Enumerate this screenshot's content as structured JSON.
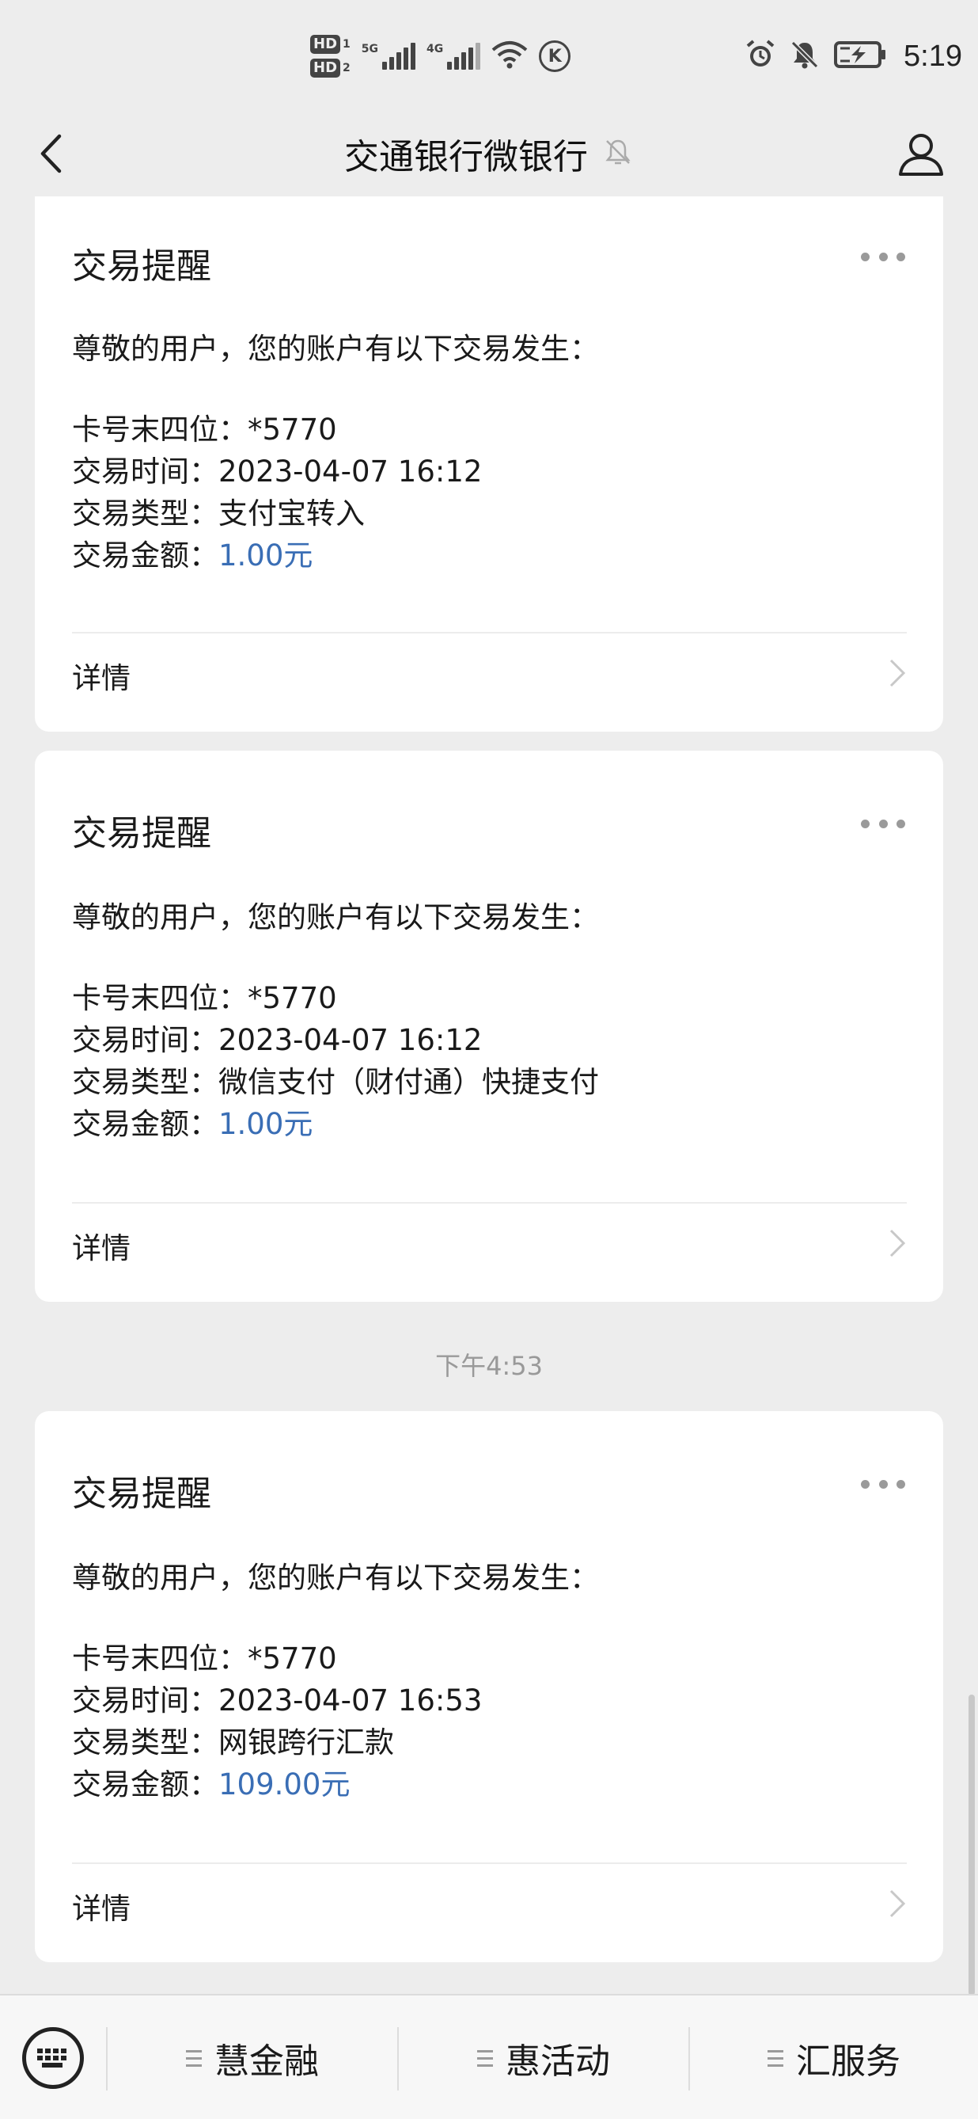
{
  "status_bar": {
    "hd1": "HD",
    "hd1_num": "1",
    "hd2": "HD",
    "hd2_num": "2",
    "sim1_network": "5G",
    "sim2_network": "4G",
    "carrier_badge": "K",
    "time": "5:19"
  },
  "header": {
    "title": "交通银行微银行"
  },
  "messages": [
    {
      "title": "交易提醒",
      "greeting": "尊敬的用户，您的账户有以下交易发生：",
      "card_label": "卡号末四位：",
      "card_value": "*5770",
      "time_label": "交易时间：",
      "time_value": "2023-04-07 16:12",
      "type_label": "交易类型：",
      "type_value": "支付宝转入",
      "amount_label": "交易金额：",
      "amount_value": "1.00元",
      "detail_label": "详情"
    },
    {
      "title": "交易提醒",
      "greeting": "尊敬的用户，您的账户有以下交易发生：",
      "card_label": "卡号末四位：",
      "card_value": "*5770",
      "time_label": "交易时间：",
      "time_value": "2023-04-07 16:12",
      "type_label": "交易类型：",
      "type_value": "微信支付（财付通）快捷支付",
      "amount_label": "交易金额：",
      "amount_value": "1.00元",
      "detail_label": "详情"
    },
    {
      "title": "交易提醒",
      "greeting": "尊敬的用户，您的账户有以下交易发生：",
      "card_label": "卡号末四位：",
      "card_value": "*5770",
      "time_label": "交易时间：",
      "time_value": "2023-04-07 16:53",
      "type_label": "交易类型：",
      "type_value": "网银跨行汇款",
      "amount_label": "交易金额：",
      "amount_value": "109.00元",
      "detail_label": "详情"
    }
  ],
  "time_divider": "下午4:53",
  "bottom_menu": {
    "items": [
      {
        "label": "慧金融"
      },
      {
        "label": "惠活动"
      },
      {
        "label": "汇服务"
      }
    ]
  },
  "colors": {
    "amount": "#3a6eb5",
    "background": "#ededed",
    "card": "#ffffff"
  }
}
